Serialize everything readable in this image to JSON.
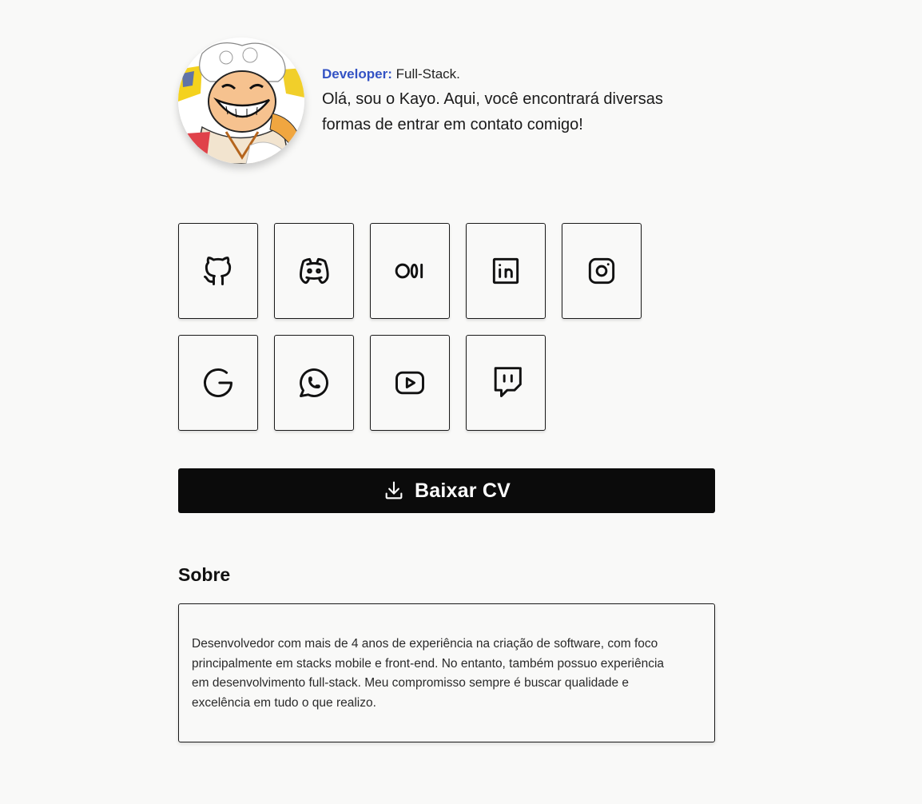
{
  "profile": {
    "avatar_alt": "avatar",
    "role_label": "Developer:",
    "role_value": "Full-Stack.",
    "greeting": "Olá, sou o Kayo. Aqui, você encontrará diversas formas de entrar em contato comigo!"
  },
  "socials": {
    "row1": [
      {
        "icon": "github-icon"
      },
      {
        "icon": "discord-icon"
      },
      {
        "icon": "medium-icon"
      },
      {
        "icon": "linkedin-icon"
      },
      {
        "icon": "instagram-icon"
      }
    ],
    "row2": [
      {
        "icon": "google-icon"
      },
      {
        "icon": "whatsapp-icon"
      },
      {
        "icon": "youtube-icon"
      },
      {
        "icon": "twitch-icon"
      }
    ]
  },
  "cv": {
    "label": "Baixar CV",
    "icon": "download-icon"
  },
  "about": {
    "title": "Sobre",
    "text": "Desenvolvedor com mais de 4 anos de experiência na criação de software, com foco principalmente em stacks mobile e front-end. No entanto, também possuo experiência em desenvolvimento full-stack. Meu compromisso sempre é buscar qualidade e excelência em tudo o que realizo."
  },
  "colors": {
    "background": "#f9f9f8",
    "accent": "#3453c4",
    "button": "#0b0b0b"
  }
}
